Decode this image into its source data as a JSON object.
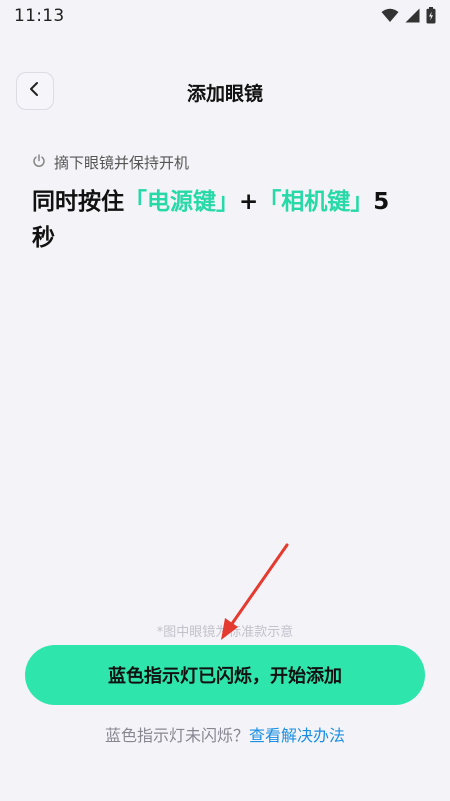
{
  "status_bar": {
    "time": "11:13",
    "icons": [
      "wifi-icon",
      "signal-icon",
      "battery-icon"
    ]
  },
  "header": {
    "title": "添加眼镜",
    "back_icon": "chevron-left-icon"
  },
  "instruction": {
    "sub_icon": "power-icon",
    "sub_text": "摘下眼镜并保持开机",
    "main_prefix": "同时按住",
    "key1": "「电源键」",
    "plus": "+",
    "key2": "「相机键」",
    "seconds": "5",
    "suffix": "秒"
  },
  "caption": "*图中眼镜为标准款示意",
  "primary_button": {
    "label": "蓝色指示灯已闪烁，开始添加"
  },
  "help": {
    "question": "蓝色指示灯未闪烁？",
    "link": "查看解决办法"
  },
  "colors": {
    "accent": "#26d9a6",
    "button": "#2ee5ac",
    "link": "#1a8fe3",
    "annotation_arrow": "#e53a2f"
  }
}
